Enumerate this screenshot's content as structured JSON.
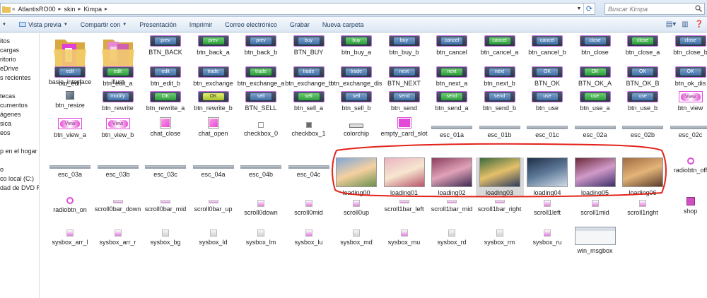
{
  "address": {
    "crumbs": [
      "AtlantisRO00",
      "skin",
      "Kimpa"
    ],
    "search_placeholder": "Buscar Kimpa"
  },
  "toolbar": {
    "items": [
      "Vista previa",
      "Compartir con",
      "Presentación",
      "Imprimir",
      "Correo electrónico",
      "Grabar",
      "Nueva carpeta"
    ]
  },
  "nav": {
    "items": [
      "itos",
      "cargas",
      "ritorio",
      "eDrive",
      "s recientes",
      "tecas",
      "cumentos",
      "ágenes",
      "sica",
      "eos",
      "p en el hogar",
      "o",
      "co local (C:)",
      "dad de DVD RW ("
    ]
  },
  "files": {
    "row0": [
      "basic_interface",
      "illust",
      "BTN_BACK",
      "btn_back_a",
      "btn_back_b",
      "BTN_BUY",
      "btn_buy_a",
      "btn_buy_b",
      "btn_cancel",
      "btn_cancel_a",
      "btn_cancel_b",
      "btn_close",
      "btn_close_a",
      "btn_close_b"
    ],
    "row0_btn": [
      "prev",
      "prev",
      "prev",
      "buy",
      "buy",
      "buy",
      "cancel",
      "cancel",
      "cancel",
      "close",
      "close",
      "close"
    ],
    "row1": [
      "btn_edit",
      "btn_edit_a",
      "btn_edit_b",
      "btn_exchange",
      "btn_exchange_a",
      "btn_exchange_b",
      "btn_exchange_dis",
      "BTN_NEXT",
      "btn_next_a",
      "btn_next_b",
      "BTN_OK",
      "BTN_OK_A",
      "BTN_OK_B",
      "btn_ok_dis"
    ],
    "row1_btn": [
      "edit",
      "edit",
      "edit",
      "trade",
      "trade",
      "trade",
      "trade",
      "next",
      "next",
      "next",
      "OK",
      "OK",
      "OK",
      "OK"
    ],
    "row2": [
      "btn_resize",
      "btn_rewrite",
      "btn_rewrite_a",
      "btn_rewrite_b",
      "BTN_SELL",
      "btn_sell_a",
      "btn_sell_b",
      "btn_send",
      "btn_send_a",
      "btn_send_b",
      "btn_use",
      "btn_use_a",
      "btn_use_b",
      "btn_view"
    ],
    "row2_btn": [
      "modify",
      "OK",
      "OK",
      "sell",
      "sell",
      "sell",
      "send",
      "send",
      "send",
      "use",
      "use",
      "use",
      "View"
    ],
    "row3": [
      "btn_view_a",
      "btn_view_b",
      "chat_close",
      "chat_open",
      "checkbox_0",
      "checkbox_1",
      "colorchip",
      "empty_card_slot",
      "esc_01a",
      "esc_01b",
      "esc_01c",
      "esc_02a",
      "esc_02b",
      "esc_02c"
    ],
    "row3_btn": [
      "View",
      "View"
    ],
    "row4": [
      "esc_03a",
      "esc_03b",
      "esc_03c",
      "esc_04a",
      "esc_04b",
      "esc_04c",
      "loading00",
      "loading01",
      "loading02",
      "loading03",
      "loading04",
      "loading05",
      "loading06",
      "radiobtn_off"
    ],
    "row5": [
      "radiobtn_on",
      "scroll0bar_down",
      "scroll0bar_mid",
      "scroll0bar_up",
      "scroll0down",
      "scroll0mid",
      "scroll0up",
      "scroll1bar_left",
      "scroll1bar_mid",
      "scroll1bar_right",
      "scroll1left",
      "scroll1mid",
      "scroll1right",
      "shop"
    ],
    "row6": [
      "sysbox_arr_l",
      "sysbox_arr_r",
      "sysbox_bg",
      "sysbox_ld",
      "sysbox_lm",
      "sysbox_lu",
      "sysbox_md",
      "sysbox_mu",
      "sysbox_rd",
      "sysbox_rm",
      "sysbox_ru",
      "win_msgbox"
    ]
  },
  "colors": {
    "annotation": "#e2231a",
    "button_border": "#c86de0",
    "pink": "#e14bd8"
  }
}
